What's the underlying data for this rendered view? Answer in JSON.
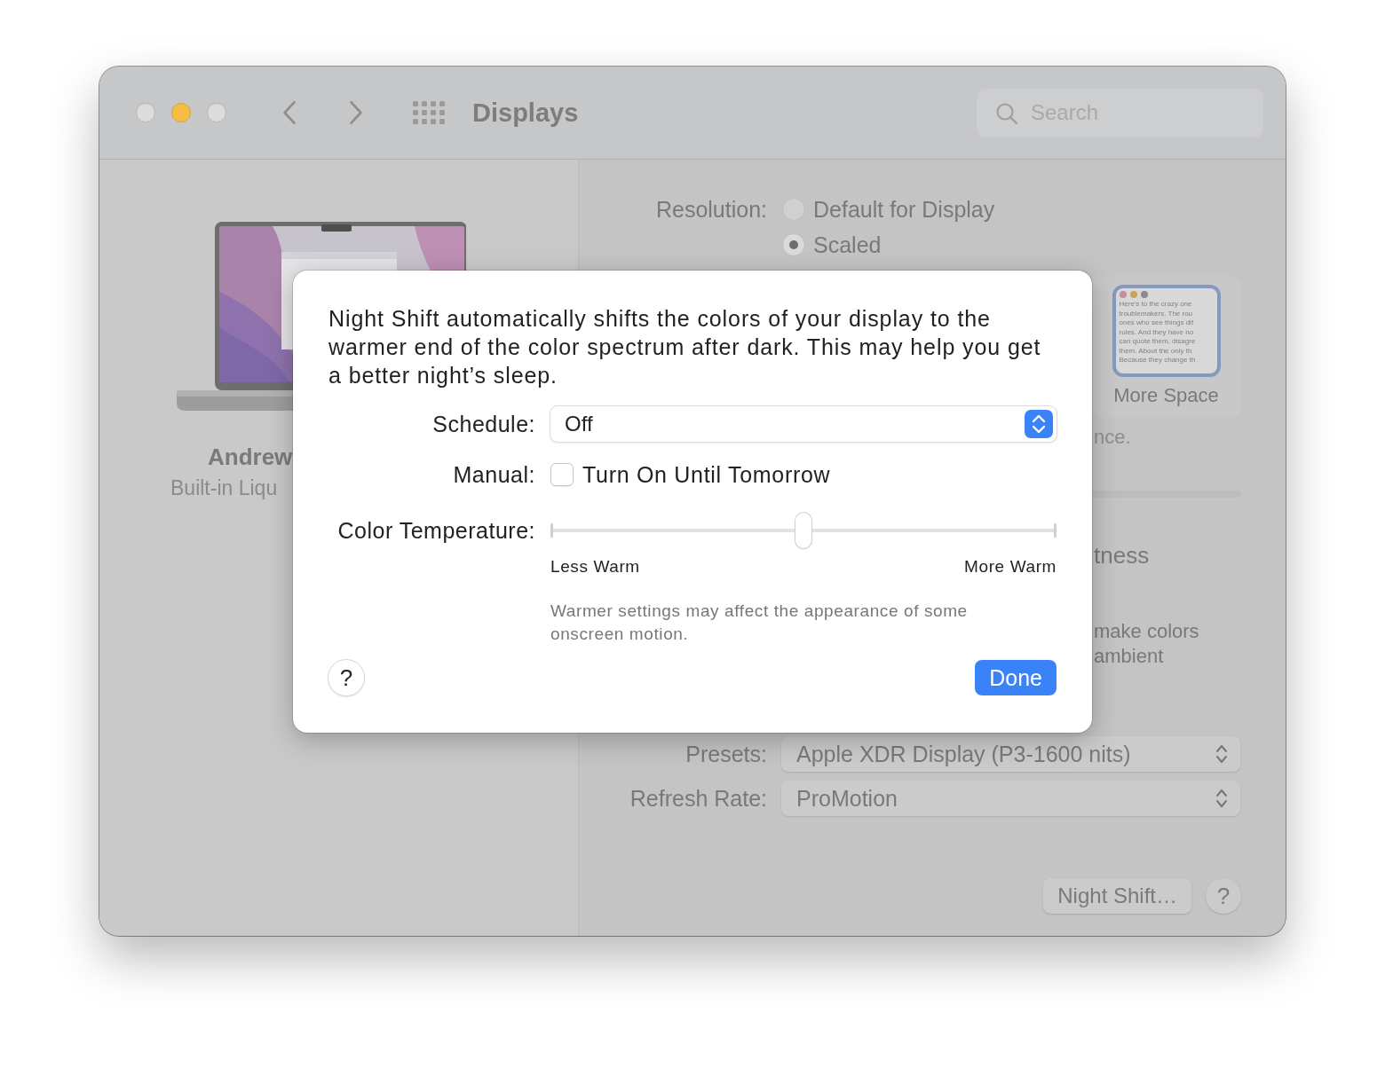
{
  "window": {
    "title": "Displays"
  },
  "search": {
    "placeholder": "Search"
  },
  "display": {
    "name": "Andrew",
    "subtitle": "Built-in Liqu"
  },
  "resolution": {
    "label": "Resolution:",
    "options": [
      {
        "label": "Default for Display",
        "selected": false
      },
      {
        "label": "Scaled",
        "selected": true
      }
    ]
  },
  "scale_option": {
    "label": "More Space",
    "selected": true,
    "preview_lines": [
      "Here's to the crazy one",
      "troublemakers. The rou",
      "ones who see things dif",
      "rules. And they have no",
      "can quote them, disagre",
      "them. About the only th",
      "Because they change th"
    ]
  },
  "text_after_card": "nce.",
  "heading": "tness",
  "description_lines": [
    "make colors",
    "ambient"
  ],
  "presets": {
    "label": "Presets:",
    "value": "Apple XDR Display (P3-1600 nits)"
  },
  "refresh_rate": {
    "label": "Refresh Rate:",
    "value": "ProMotion"
  },
  "footer_buttons": {
    "night_shift": "Night Shift…",
    "help": "?"
  },
  "sheet": {
    "description": "Night Shift automatically shifts the colors of your display to the warmer end of the color spectrum after dark. This may help you get a better night’s sleep.",
    "schedule": {
      "label": "Schedule:",
      "value": "Off"
    },
    "manual": {
      "label": "Manual:",
      "option": "Turn On Until Tomorrow",
      "checked": false
    },
    "color_temperature": {
      "label": "Color Temperature:",
      "level": 0.5,
      "min_label": "Less Warm",
      "max_label": "More Warm"
    },
    "note": "Warmer settings may affect the appearance of some onscreen motion.",
    "help": "?",
    "done": "Done"
  }
}
